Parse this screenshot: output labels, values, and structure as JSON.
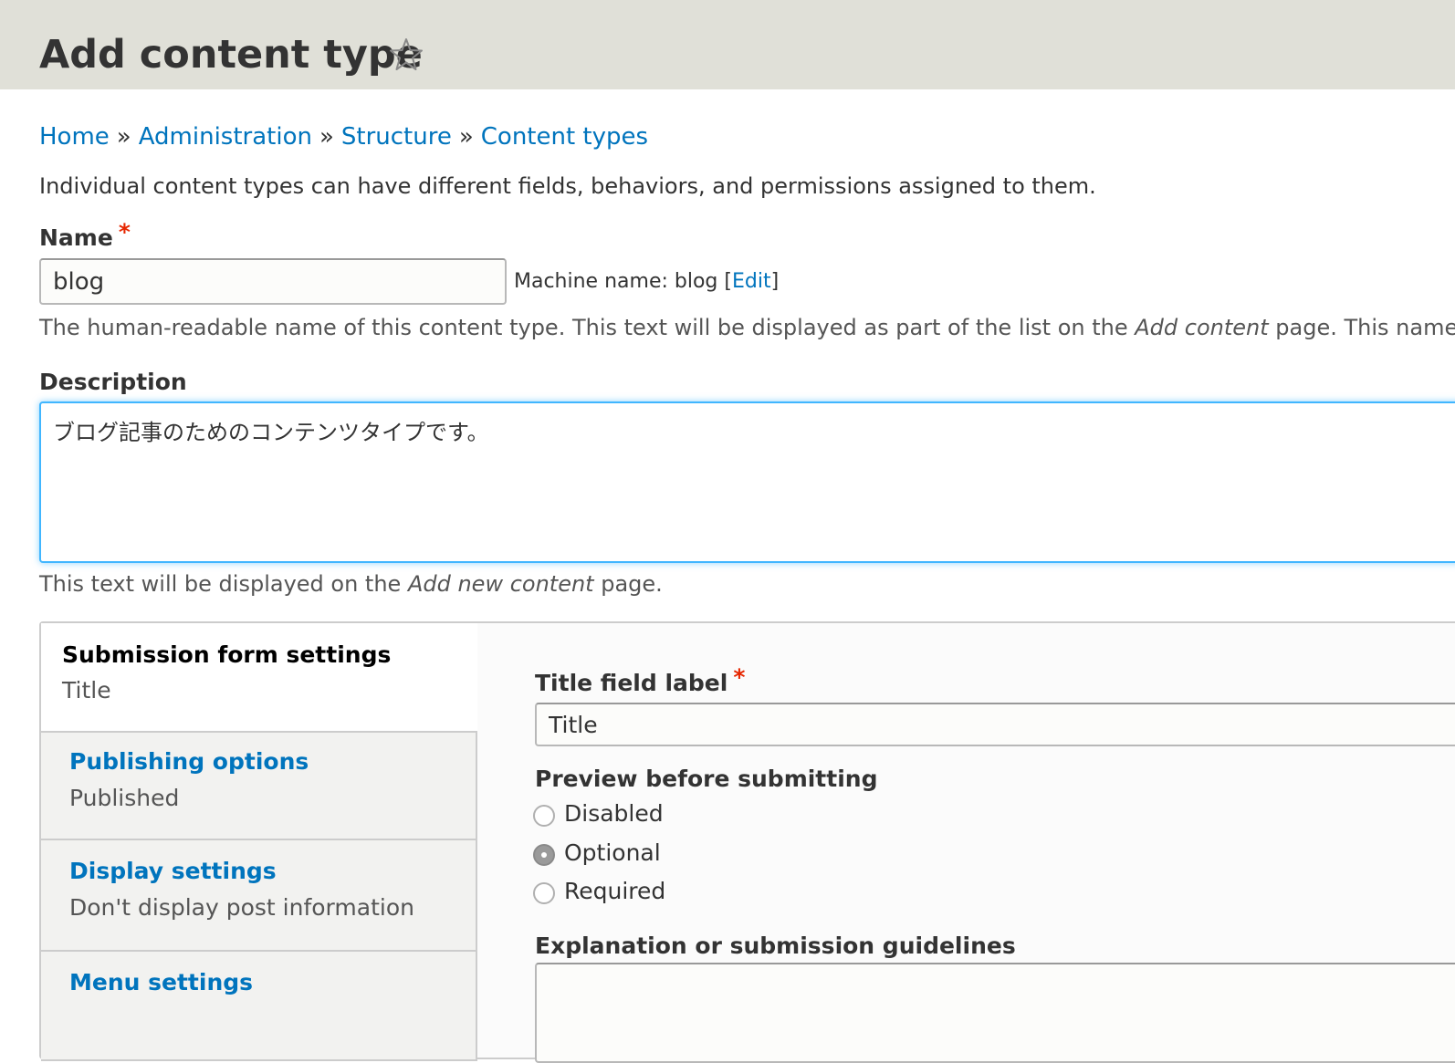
{
  "header": {
    "title": "Add content type",
    "shortcut_icon": "star-outline-icon"
  },
  "breadcrumb": {
    "items": [
      "Home",
      "Administration",
      "Structure",
      "Content types"
    ],
    "separator": "»"
  },
  "intro": "Individual content types can have different fields, behaviors, and permissions assigned to them.",
  "name_field": {
    "label": "Name",
    "required_marker": "*",
    "value": "blog",
    "machine_name_prefix": "Machine name: blog [",
    "machine_name_edit": "Edit",
    "machine_name_suffix": "]",
    "help_prefix": "The human-readable name of this content type. This text will be displayed as part of the list on the ",
    "help_emphasis": "Add content",
    "help_suffix": " page. This name"
  },
  "description_field": {
    "label": "Description",
    "value": "ブログ記事のためのコンテンツタイプです。",
    "help_prefix": "This text will be displayed on the ",
    "help_emphasis": "Add new content",
    "help_suffix": " page."
  },
  "vertical_tabs": {
    "tabs": [
      {
        "title": "Submission form settings",
        "summary": "Title",
        "selected": true
      },
      {
        "title": "Publishing options",
        "summary": "Published",
        "selected": false
      },
      {
        "title": "Display settings",
        "summary": "Don't display post information",
        "selected": false
      },
      {
        "title": "Menu settings",
        "summary": "",
        "selected": false
      }
    ]
  },
  "submission_pane": {
    "title_label": "Title field label",
    "title_required_marker": "*",
    "title_value": "Title",
    "preview_label": "Preview before submitting",
    "preview_options": [
      "Disabled",
      "Optional",
      "Required"
    ],
    "preview_selected": "Optional",
    "guidelines_label": "Explanation or submission guidelines",
    "guidelines_value": ""
  },
  "colors": {
    "link": "#0074bd",
    "required": "#e62600",
    "header_bg": "#e0e0d8",
    "focus_border": "#40b6ff"
  }
}
